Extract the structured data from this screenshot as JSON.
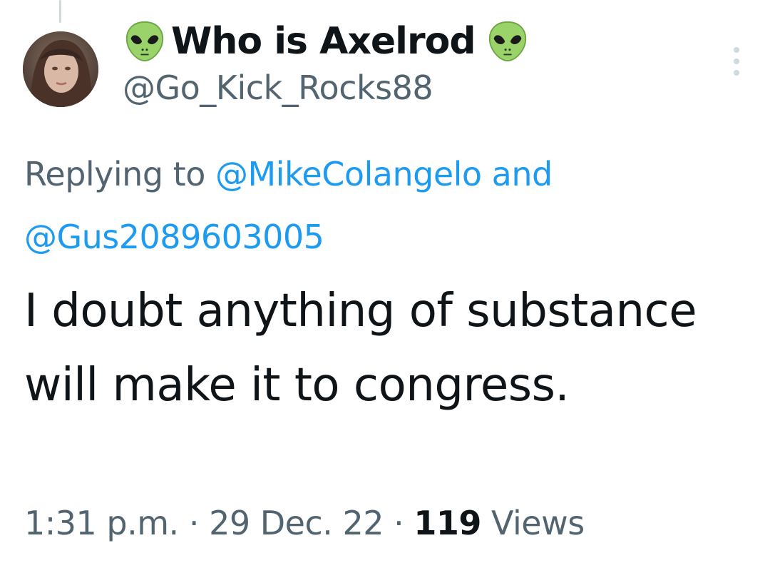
{
  "tweet": {
    "author": {
      "display_name": "Who is Axelrod",
      "handle": "@Go_Kick_Rocks88",
      "name_emoji": "alien-emoji"
    },
    "reply": {
      "prefix": "Replying to",
      "mention_1": "@MikeColangelo",
      "joiner": "and",
      "mention_2": "@Gus2089603005"
    },
    "text": "I doubt anything of substance will make it to congress.",
    "meta": {
      "time": "1:31 p.m.",
      "separator": "·",
      "date": "29 Dec. 22",
      "views_count": "119",
      "views_label": "Views"
    }
  },
  "colors": {
    "text_primary": "#0f1419",
    "text_secondary": "#536471",
    "link": "#1d9bf0",
    "divider": "#cfd9de"
  }
}
